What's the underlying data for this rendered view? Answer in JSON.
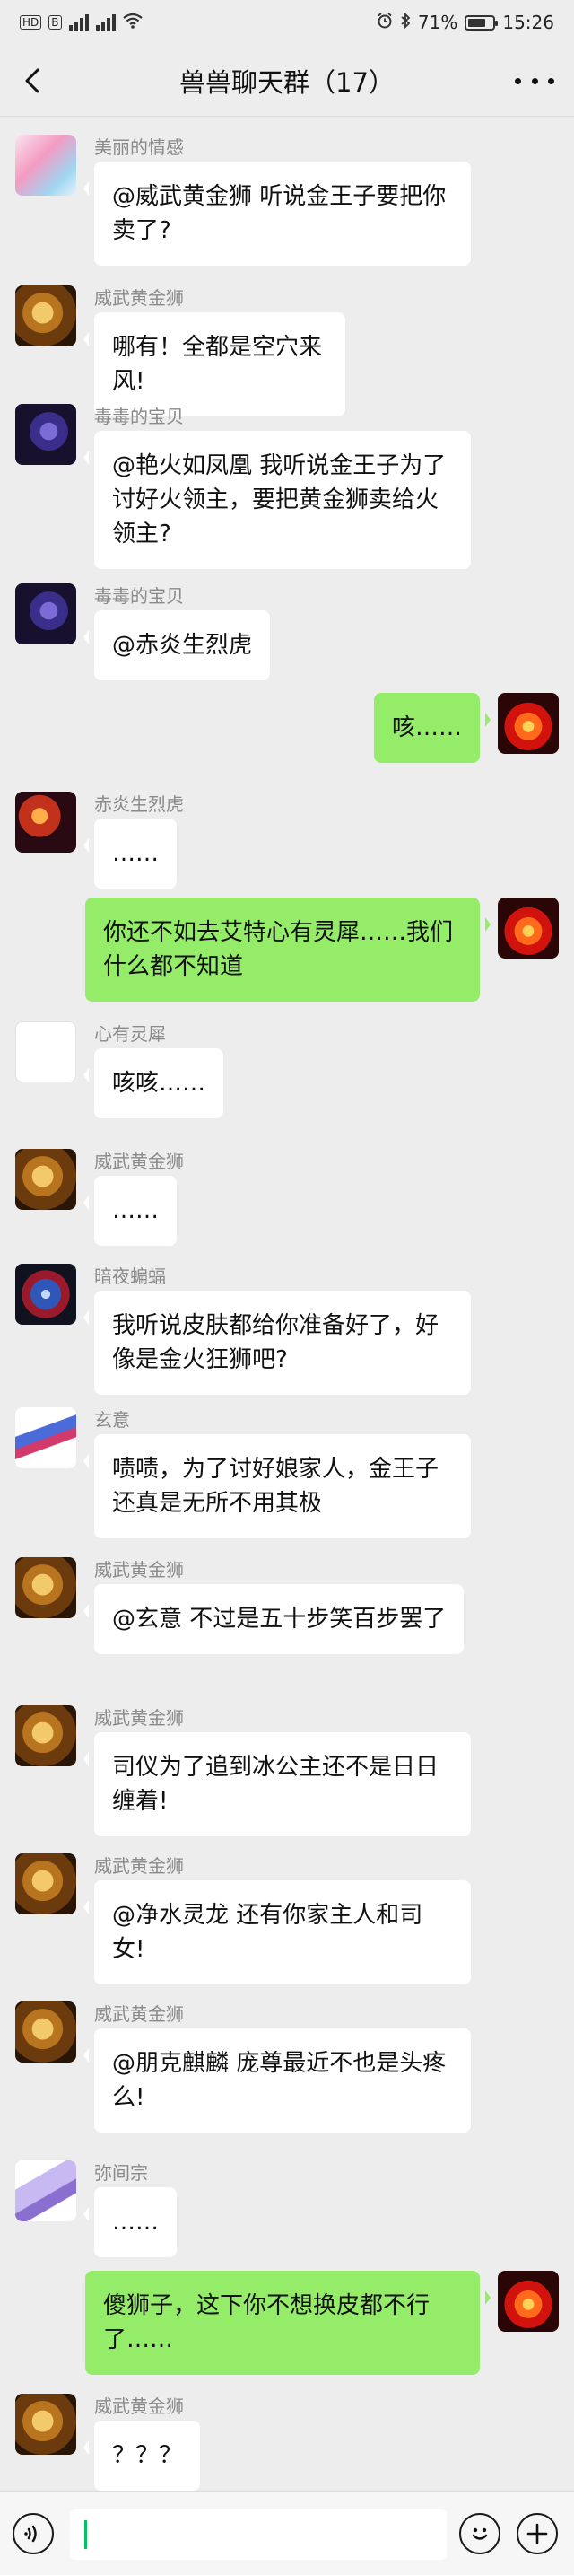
{
  "status_bar": {
    "network_tag": "HD",
    "network_tag2": "B",
    "signal_label": "4G",
    "battery_percent": "71%",
    "battery_level": 0.71,
    "time": "15:26"
  },
  "header": {
    "title": "兽兽聊天群（17）",
    "back_icon": "chevron-left-icon",
    "more_icon": "more-dots-icon"
  },
  "messages": [
    {
      "side": "left",
      "sender": "美丽的情感",
      "avatar": "av-pink",
      "text": "@威武黄金狮 听说金王子要把你卖了?"
    },
    {
      "side": "left",
      "sender": "威武黄金狮",
      "avatar": "av-lion",
      "text": "哪有！全都是空穴来风!"
    },
    {
      "side": "left",
      "sender": "毒毒的宝贝",
      "avatar": "av-purple",
      "text": "@艳火如凤凰 我听说金王子为了讨好火领主，要把黄金狮卖给火领主?"
    },
    {
      "side": "left",
      "sender": "毒毒的宝贝",
      "avatar": "av-purple",
      "text": "@赤炎生烈虎"
    },
    {
      "side": "right",
      "avatar": "av-phoenix",
      "text": "咳……"
    },
    {
      "side": "left",
      "sender": "赤炎生烈虎",
      "avatar": "av-tiger",
      "text": "……"
    },
    {
      "side": "right",
      "avatar": "av-phoenix",
      "text": "你还不如去艾特心有灵犀……我们什么都不知道"
    },
    {
      "side": "left",
      "sender": "心有灵犀",
      "avatar": "av-cute",
      "text": "咳咳……"
    },
    {
      "side": "left",
      "sender": "威武黄金狮",
      "avatar": "av-lion",
      "text": "……"
    },
    {
      "side": "left",
      "sender": "暗夜蝙蝠",
      "avatar": "av-bat",
      "text": "我听说皮肤都给你准备好了，好像是金火狂狮吧?"
    },
    {
      "side": "left",
      "sender": "玄意",
      "avatar": "av-xuan",
      "text": "啧啧，为了讨好娘家人，金王子还真是无所不用其极"
    },
    {
      "side": "left",
      "sender": "威武黄金狮",
      "avatar": "av-lion",
      "text": "@玄意 不过是五十步笑百步罢了"
    },
    {
      "side": "left",
      "sender": "威武黄金狮",
      "avatar": "av-lion",
      "text": "司仪为了追到冰公主还不是日日缠着!"
    },
    {
      "side": "left",
      "sender": "威武黄金狮",
      "avatar": "av-lion",
      "text": "@净水灵龙 还有你家主人和司女!"
    },
    {
      "side": "left",
      "sender": "威武黄金狮",
      "avatar": "av-lion",
      "text": "@朋克麒麟 庞尊最近不也是头疼么!"
    },
    {
      "side": "left",
      "sender": "弥间宗",
      "avatar": "av-unicorn",
      "text": "……"
    },
    {
      "side": "right",
      "avatar": "av-phoenix",
      "text": "傻狮子，这下你不想换皮都不行了……"
    },
    {
      "side": "left",
      "sender": "威武黄金狮",
      "avatar": "av-lion",
      "text": "？？？"
    }
  ],
  "input_bar": {
    "voice_icon": "voice-icon",
    "emoji_icon": "emoji-icon",
    "plus_icon": "plus-icon",
    "value": ""
  },
  "colors": {
    "background": "#ededed",
    "bubble_self": "#95ec69",
    "bubble_other": "#ffffff",
    "caret": "#07c160"
  }
}
